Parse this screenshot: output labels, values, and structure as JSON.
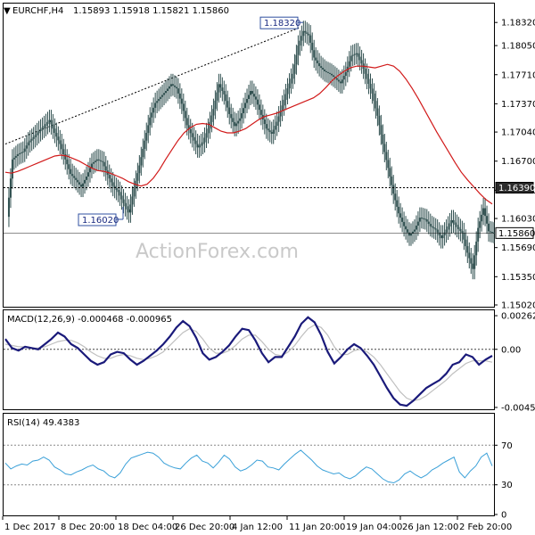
{
  "header": {
    "symbol": "EURCHF,H4",
    "ohlc": "1.15893 1.15918 1.15821 1.15860",
    "marker": "▼"
  },
  "watermark": "ActionForex.com",
  "colors": {
    "candle": "#2f4f4f",
    "ma": "#d11a1a",
    "macd": "#1a1a7a",
    "signal": "#bfbfbf",
    "rsi": "#3aa0d8",
    "grid": "#999999",
    "axis": "#000000"
  },
  "chart_data": [
    {
      "type": "candlestick",
      "title": "EURCHF,H4",
      "ylim": [
        1.1502,
        1.1852
      ],
      "yticks": [
        "1.18320",
        "1.18050",
        "1.17710",
        "1.17370",
        "1.17040",
        "1.16700",
        "1.16360",
        "1.16030",
        "1.15690",
        "1.15350",
        "1.15020"
      ],
      "ytick_values": [
        1.1832,
        1.1805,
        1.1771,
        1.1737,
        1.1704,
        1.167,
        1.1636,
        1.1603,
        1.1569,
        1.1535,
        1.1502
      ],
      "price_labels": [
        {
          "text": "1.16390",
          "value": 1.1639,
          "style": "dark"
        },
        {
          "text": "1.15860",
          "value": 1.1586,
          "style": "light"
        }
      ],
      "annotations": [
        {
          "text": "1.18320",
          "value": 1.1832
        },
        {
          "text": "1.16020",
          "value": 1.1602
        }
      ],
      "series": [
        {
          "name": "price",
          "values": [
            1.1605,
            1.1672,
            1.1678,
            1.1681,
            1.1692,
            1.1698,
            1.1705,
            1.1711,
            1.1718,
            1.1703,
            1.169,
            1.1672,
            1.1655,
            1.1648,
            1.164,
            1.1652,
            1.1667,
            1.1672,
            1.1669,
            1.1654,
            1.1641,
            1.1634,
            1.1621,
            1.161,
            1.1638,
            1.1665,
            1.1694,
            1.1721,
            1.1738,
            1.1745,
            1.1752,
            1.176,
            1.1755,
            1.1737,
            1.1712,
            1.1698,
            1.1686,
            1.1692,
            1.1708,
            1.1731,
            1.176,
            1.1748,
            1.1725,
            1.1711,
            1.172,
            1.1738,
            1.1752,
            1.1742,
            1.1724,
            1.1708,
            1.1702,
            1.1716,
            1.1735,
            1.1755,
            1.1772,
            1.1805,
            1.1822,
            1.1817,
            1.1791,
            1.1781,
            1.1775,
            1.1772,
            1.1767,
            1.1761,
            1.1774,
            1.1793,
            1.1796,
            1.1784,
            1.1766,
            1.1749,
            1.1723,
            1.169,
            1.1662,
            1.1632,
            1.1609,
            1.1594,
            1.1583,
            1.159,
            1.1604,
            1.1602,
            1.1594,
            1.159,
            1.158,
            1.159,
            1.1601,
            1.1593,
            1.1586,
            1.1563,
            1.1544,
            1.1592,
            1.1615,
            1.1588,
            1.1586
          ]
        },
        {
          "name": "ma",
          "values": [
            1.1657,
            1.1656,
            1.1658,
            1.1661,
            1.1664,
            1.1667,
            1.167,
            1.1673,
            1.1676,
            1.1677,
            1.1676,
            1.1673,
            1.167,
            1.1666,
            1.1662,
            1.1659,
            1.1658,
            1.1656,
            1.1653,
            1.165,
            1.1646,
            1.1643,
            1.1641,
            1.1643,
            1.165,
            1.166,
            1.1672,
            1.1683,
            1.1694,
            1.1703,
            1.1709,
            1.1713,
            1.1714,
            1.1713,
            1.1709,
            1.1705,
            1.1703,
            1.1703,
            1.1705,
            1.1708,
            1.1713,
            1.1718,
            1.1722,
            1.1724,
            1.1726,
            1.1729,
            1.1732,
            1.1735,
            1.1738,
            1.1741,
            1.1744,
            1.1749,
            1.1756,
            1.1764,
            1.177,
            1.1775,
            1.1779,
            1.1781,
            1.1781,
            1.178,
            1.1779,
            1.1781,
            1.1783,
            1.1781,
            1.1775,
            1.1766,
            1.1755,
            1.1743,
            1.173,
            1.1717,
            1.1704,
            1.1692,
            1.168,
            1.1668,
            1.1657,
            1.1648,
            1.164,
            1.1632,
            1.1625,
            1.162
          ]
        }
      ]
    },
    {
      "type": "line",
      "title": "MACD(12,26,9) -0.000468 -0.000965",
      "ylim": [
        -0.0046,
        0.0029
      ],
      "yticks": [
        "0.00262",
        "0.00",
        "-0.004526"
      ],
      "ytick_values": [
        0.00262,
        0.0,
        -0.004526
      ],
      "series": [
        {
          "name": "MACD",
          "values": [
            0.0008,
            0.0001,
            -0.0001,
            0.0002,
            0.0001,
            0.0,
            0.0004,
            0.0008,
            0.0013,
            0.001,
            0.0004,
            0.0001,
            -0.0004,
            -0.0009,
            -0.0012,
            -0.001,
            -0.0004,
            -0.0002,
            -0.0003,
            -0.0008,
            -0.0012,
            -0.0009,
            -0.0005,
            -0.0001,
            0.0004,
            0.001,
            0.0017,
            0.0022,
            0.0018,
            0.0009,
            -0.0003,
            -0.0008,
            -0.0006,
            -0.0002,
            0.0003,
            0.001,
            0.0016,
            0.0015,
            0.0007,
            -0.0003,
            -0.001,
            -0.0006,
            -0.0006,
            0.0002,
            0.001,
            0.002,
            0.0025,
            0.0021,
            0.0011,
            -0.0002,
            -0.0011,
            -0.0006,
            0.0,
            0.0004,
            0.0001,
            -0.0005,
            -0.0012,
            -0.0021,
            -0.003,
            -0.0038,
            -0.0043,
            -0.0044,
            -0.004,
            -0.0035,
            -0.003,
            -0.0027,
            -0.0024,
            -0.0019,
            -0.0012,
            -0.001,
            -0.0004,
            -0.0006,
            -0.0012,
            -0.0008,
            -0.0005
          ]
        },
        {
          "name": "Signal",
          "values": [
            0.0004,
            0.0003,
            0.0002,
            0.0002,
            0.0001,
            0.0001,
            0.0002,
            0.0004,
            0.0006,
            0.0007,
            0.0007,
            0.0005,
            0.0002,
            -0.0002,
            -0.0005,
            -0.0007,
            -0.0007,
            -0.0005,
            -0.0004,
            -0.0005,
            -0.0007,
            -0.0008,
            -0.0007,
            -0.0005,
            -0.0002,
            0.0003,
            0.0008,
            0.0013,
            0.0016,
            0.0014,
            0.0008,
            0.0001,
            -0.0003,
            -0.0003,
            -0.0001,
            0.0003,
            0.0008,
            0.0011,
            0.0011,
            0.0006,
            0.0,
            -0.0004,
            -0.0005,
            -0.0002,
            0.0003,
            0.001,
            0.0016,
            0.0019,
            0.0017,
            0.0011,
            0.0002,
            -0.0004,
            -0.0004,
            -0.0001,
            0.0,
            -0.0002,
            -0.0006,
            -0.0012,
            -0.0019,
            -0.0026,
            -0.0033,
            -0.0038,
            -0.004,
            -0.0039,
            -0.0036,
            -0.0032,
            -0.0028,
            -0.0024,
            -0.0019,
            -0.0015,
            -0.0011,
            -0.0009,
            -0.0009,
            -0.0009,
            -0.001
          ]
        }
      ]
    },
    {
      "type": "line",
      "title": "RSI(14) 49.4383",
      "ylim": [
        0,
        100
      ],
      "yticks": [
        "70",
        "30",
        "0"
      ],
      "ytick_values": [
        70,
        30,
        0
      ],
      "series": [
        {
          "name": "RSI",
          "values": [
            52,
            46,
            49,
            51,
            50,
            54,
            55,
            58,
            55,
            48,
            45,
            41,
            40,
            43,
            45,
            48,
            50,
            46,
            44,
            39,
            37,
            42,
            51,
            57,
            59,
            61,
            63,
            62,
            58,
            52,
            49,
            47,
            46,
            52,
            57,
            60,
            54,
            52,
            47,
            53,
            60,
            56,
            48,
            44,
            46,
            50,
            55,
            54,
            48,
            47,
            45,
            51,
            56,
            61,
            65,
            60,
            55,
            49,
            45,
            43,
            41,
            42,
            38,
            36,
            39,
            44,
            48,
            46,
            41,
            36,
            33,
            32,
            35,
            41,
            44,
            40,
            37,
            40,
            45,
            48,
            52,
            55,
            58,
            43,
            37,
            44,
            49,
            58,
            62,
            49
          ]
        }
      ]
    }
  ],
  "xaxis": {
    "labels": [
      "1 Dec 2017",
      "8 Dec 20:00",
      "18 Dec 04:00",
      "26 Dec 20:00",
      "4 Jan 12:00",
      "11 Jan 20:00",
      "19 Jan 04:00",
      "26 Jan 12:00",
      "2 Feb 20:00"
    ]
  }
}
